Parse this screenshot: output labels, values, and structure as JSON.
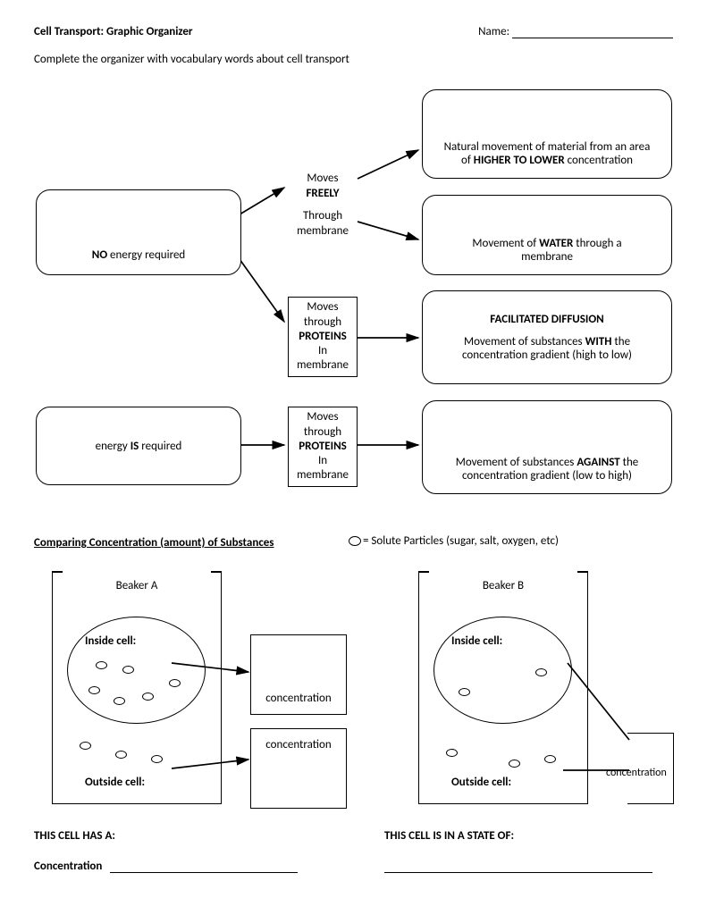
{
  "header": {
    "title": "Cell Transport: Graphic Organizer",
    "name_label": "Name:"
  },
  "instruction": "Complete the organizer with vocabulary words about cell transport",
  "left_boxes": {
    "no_energy_pre": "NO",
    "no_energy_post": " energy required",
    "is_energy_pre": "energy ",
    "is_energy_mid": "IS",
    "is_energy_post": " required"
  },
  "mid_labels": {
    "freely_l1": "Moves",
    "freely_l2": "FREELY",
    "through_l1": "Through",
    "through_l2": "membrane",
    "proteins_l1": "Moves",
    "proteins_l2": "through",
    "proteins_l3": "PROTEINS",
    "proteins_l4": "In",
    "proteins_l5": "membrane"
  },
  "right_boxes": {
    "r1_l1": "Natural movement of material from an area",
    "r1_l2a": "of ",
    "r1_l2b": "HIGHER TO LOWER",
    "r1_l2c": " concentration",
    "r2_l1a": "Movement of ",
    "r2_l1b": "WATER",
    "r2_l1c": " through a",
    "r2_l2": "membrane",
    "r3_t": "FACILITATED DIFFUSION",
    "r3_l1a": "Movement of substances ",
    "r3_l1b": "WITH",
    "r3_l1c": " the",
    "r3_l2": "concentration gradient (high to low)",
    "r4_l1a": "Movement of substances ",
    "r4_l1b": "AGAINST",
    "r4_l1c": " the",
    "r4_l2": "concentration gradient (low to high)"
  },
  "section2": {
    "heading": "Comparing Concentration (amount) of Substances",
    "legend": "= Solute Particles (sugar, salt, oxygen, etc)",
    "beakerA": "Beaker A",
    "beakerB": "Beaker B",
    "inside": "Inside cell:",
    "outside": "Outside cell:",
    "concentration": "concentration",
    "hasA": "THIS CELL HAS A:",
    "stateOf": "THIS CELL IS IN A STATE OF:",
    "conc_label": "Concentration"
  }
}
